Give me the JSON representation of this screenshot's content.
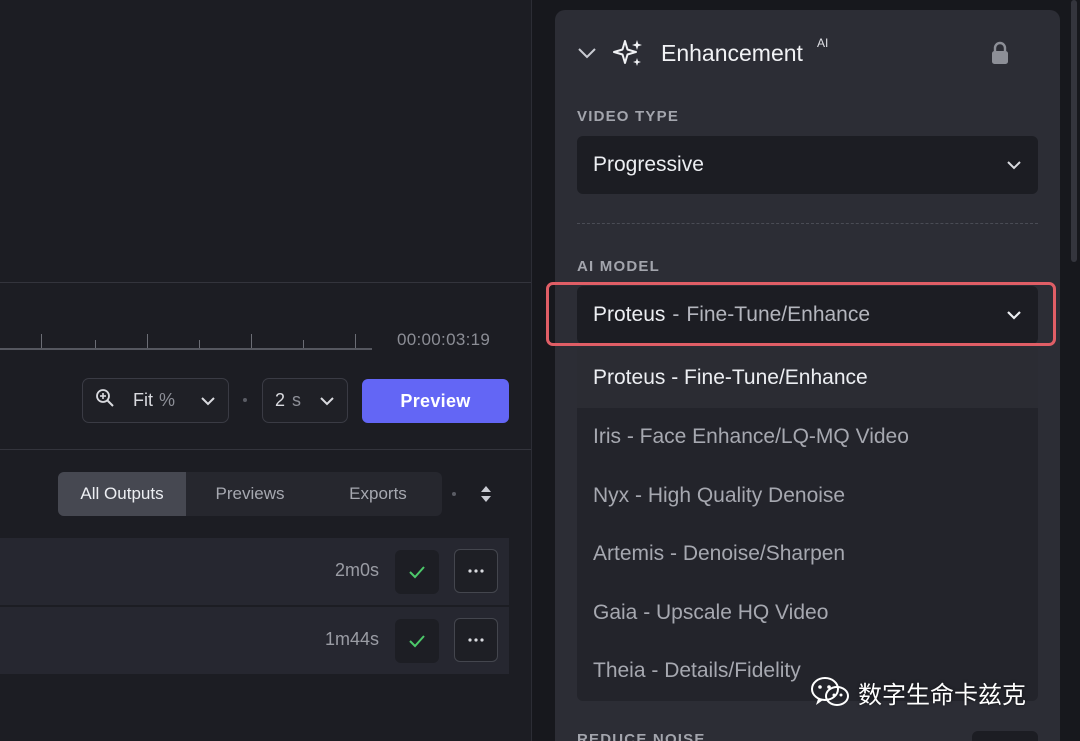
{
  "timeline": {
    "timecode": "00:00:03:19"
  },
  "controls": {
    "zoom_label": "Fit",
    "zoom_unit": "%",
    "duration_value": "2",
    "duration_unit": "s",
    "preview_label": "Preview"
  },
  "output_tabs": [
    {
      "label": "All Outputs",
      "active": true
    },
    {
      "label": "Previews",
      "active": false
    },
    {
      "label": "Exports",
      "active": false
    }
  ],
  "outputs": [
    {
      "duration": "2m0s",
      "status": "done"
    },
    {
      "duration": "1m44s",
      "status": "done"
    }
  ],
  "panel": {
    "title": "Enhancement",
    "title_badge": "AI",
    "video_type_label": "VIDEO TYPE",
    "video_type_value": "Progressive",
    "ai_model_label": "AI MODEL",
    "ai_model_selected": {
      "name": "Proteus",
      "separator": "-",
      "desc": "Fine-Tune/Enhance"
    },
    "model_options": [
      "Proteus - Fine-Tune/Enhance",
      "Iris - Face Enhance/LQ-MQ Video",
      "Nyx - High Quality Denoise",
      "Artemis - Denoise/Sharpen",
      "Gaia - Upscale HQ Video",
      "Theia - Details/Fidelity"
    ],
    "reduce_noise_label": "REDUCE NOISE"
  },
  "watermark": {
    "text": "数字生命卡兹克"
  },
  "colors": {
    "accent": "#6366f5",
    "highlight_border": "#e05e66",
    "check_green": "#4cc96a",
    "panel_bg": "#2c2d35"
  },
  "icons": [
    "zoom-in-icon",
    "chevron-down-icon",
    "sort-icon",
    "check-icon",
    "more-icon",
    "sparkles-icon",
    "lock-icon",
    "wechat-icon"
  ]
}
